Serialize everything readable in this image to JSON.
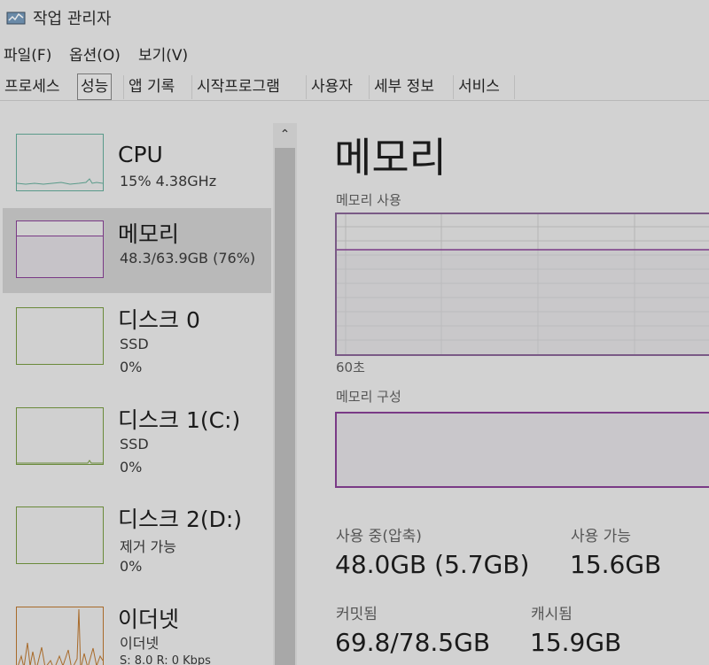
{
  "window": {
    "title": "작업 관리자"
  },
  "menu": {
    "file": "파일(F)",
    "options": "옵션(O)",
    "view": "보기(V)"
  },
  "tabs": [
    {
      "label": "프로세스"
    },
    {
      "label": "성능"
    },
    {
      "label": "앱 기록"
    },
    {
      "label": "시작프로그램"
    },
    {
      "label": "사용자"
    },
    {
      "label": "세부 정보"
    },
    {
      "label": "서비스"
    }
  ],
  "active_tab": "성능",
  "sidebar": {
    "items": [
      {
        "title": "CPU",
        "sub1": "15%  4.38GHz",
        "sub2": ""
      },
      {
        "title": "메모리",
        "sub1": "48.3/63.9GB (76%)",
        "sub2": ""
      },
      {
        "title": "디스크 0",
        "sub1": "SSD",
        "sub2": "0%"
      },
      {
        "title": "디스크 1(C:)",
        "sub1": "SSD",
        "sub2": "0%"
      },
      {
        "title": "디스크 2(D:)",
        "sub1": "제거 가능",
        "sub2": "0%"
      },
      {
        "title": "이더넷",
        "sub1": "이더넷",
        "sub2": "S: 8.0  R: 0 Kbps"
      }
    ],
    "selected": "메모리"
  },
  "main": {
    "title": "메모리",
    "usage_label": "메모리 사용",
    "time_label": "60초",
    "composition_label": "메모리 구성",
    "in_use_label": "사용 중(압축)",
    "in_use_value": "48.0GB (5.7GB)",
    "available_label": "사용 가능",
    "available_value": "15.6GB",
    "committed_label": "커밋됨",
    "committed_value": "69.8/78.5GB",
    "cached_label": "캐시됨",
    "cached_value": "15.9GB"
  },
  "colors": {
    "cpu_line": "#5a9a8a",
    "memory_line": "#7a3a86",
    "disk_line": "#6a8a3a",
    "ethernet_line": "#a86a2a"
  }
}
